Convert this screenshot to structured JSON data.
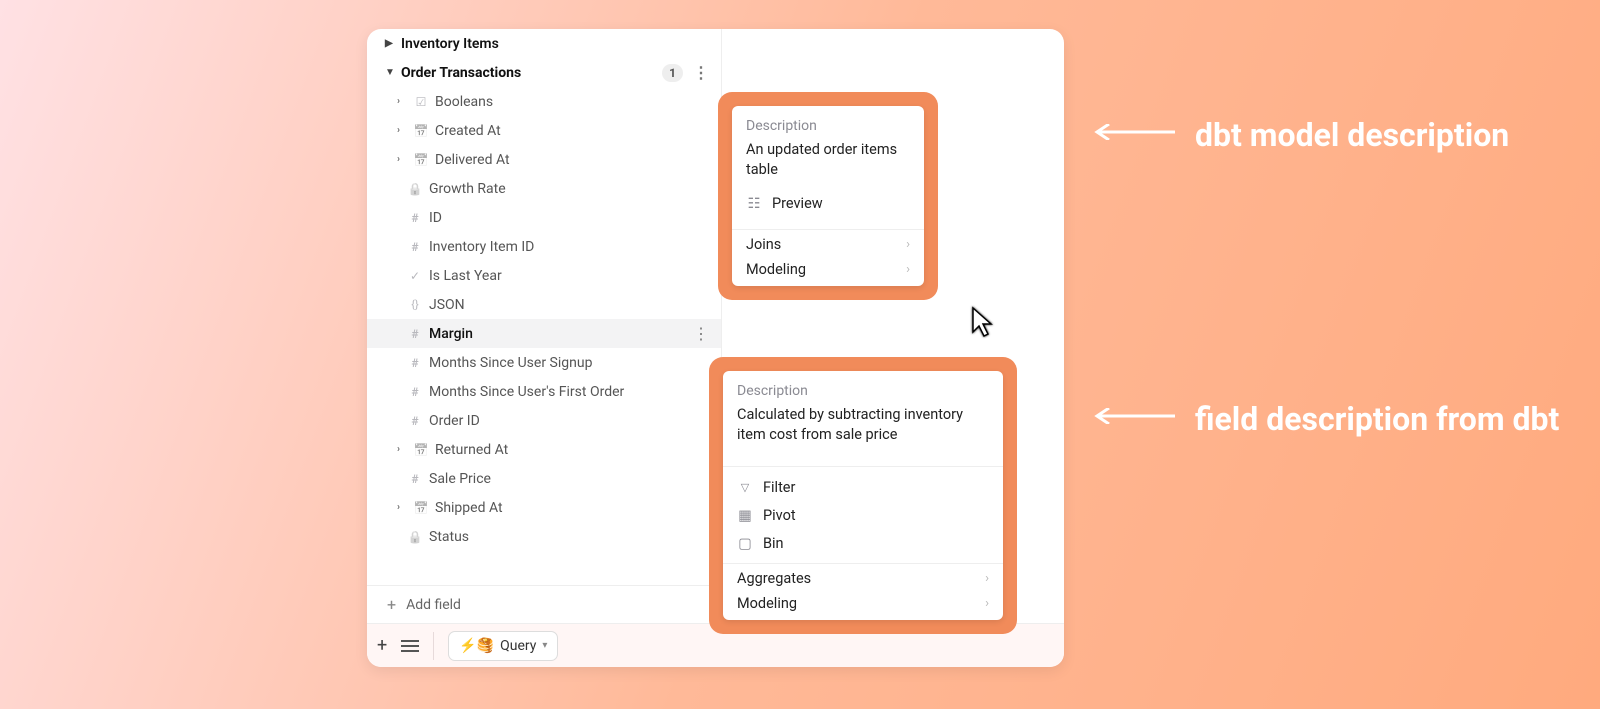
{
  "colors": {
    "accent_orange": "#f18b5a"
  },
  "sidebar": {
    "tables": {
      "inventory": {
        "label": "Inventory Items"
      },
      "orders": {
        "label": "Order Transactions",
        "badge": "1"
      }
    },
    "fields": {
      "booleans": {
        "label": "Booleans",
        "icon": "bool-icon"
      },
      "created": {
        "label": "Created At",
        "icon": "calendar-icon"
      },
      "delivered": {
        "label": "Delivered At",
        "icon": "calendar-icon"
      },
      "growth": {
        "label": "Growth Rate",
        "icon": "lock-icon"
      },
      "id": {
        "label": "ID",
        "icon": "number-icon"
      },
      "inv_item": {
        "label": "Inventory Item ID",
        "icon": "number-icon"
      },
      "last_year": {
        "label": "Is Last Year",
        "icon": "check-icon"
      },
      "json": {
        "label": "JSON",
        "icon": "json-icon"
      },
      "margin": {
        "label": "Margin",
        "icon": "number-icon"
      },
      "m_signup": {
        "label": "Months Since User Signup",
        "icon": "number-icon"
      },
      "m_first": {
        "label": "Months Since User's First Order",
        "icon": "number-icon"
      },
      "order_id": {
        "label": "Order ID",
        "icon": "number-icon"
      },
      "returned": {
        "label": "Returned At",
        "icon": "calendar-icon"
      },
      "sale_price": {
        "label": "Sale Price",
        "icon": "number-icon"
      },
      "shipped": {
        "label": "Shipped At",
        "icon": "calendar-icon"
      },
      "status": {
        "label": "Status",
        "icon": "lock-icon"
      }
    },
    "add_field": "Add field"
  },
  "toolbar": {
    "query_label": "Query",
    "query_emoji": "⚡🥞"
  },
  "popups": {
    "model": {
      "title": "Description",
      "body": "An updated order items table",
      "preview": "Preview",
      "joins": "Joins",
      "modeling": "Modeling"
    },
    "field": {
      "title": "Description",
      "body": "Calculated by subtracting inventory item cost from sale price",
      "filter": "Filter",
      "pivot": "Pivot",
      "bin": "Bin",
      "aggregates": "Aggregates",
      "modeling": "Modeling"
    }
  },
  "annotations": {
    "model": "dbt model description",
    "field": "field description from dbt"
  }
}
